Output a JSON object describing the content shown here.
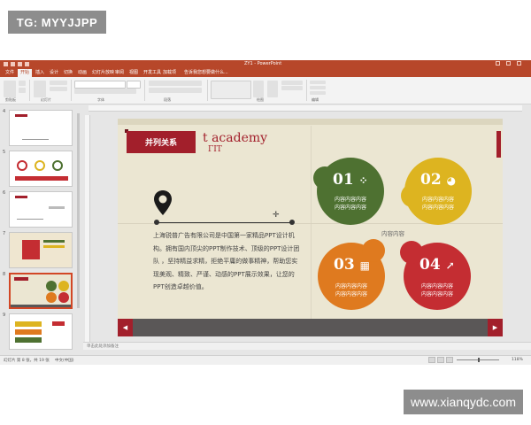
{
  "watermark_top": "TG: MYYJJPP",
  "watermark_bottom": "www.xianqydc.com",
  "window": {
    "doc_title": "ZY1 - PowerPoint"
  },
  "ribbon_tabs": [
    {
      "label": "文件",
      "active": false
    },
    {
      "label": "开始",
      "active": true
    },
    {
      "label": "插入",
      "active": false
    },
    {
      "label": "设计",
      "active": false
    },
    {
      "label": "切换",
      "active": false
    },
    {
      "label": "动画",
      "active": false
    },
    {
      "label": "幻灯片放映",
      "active": false
    },
    {
      "label": "审阅",
      "active": false
    },
    {
      "label": "视图",
      "active": false
    },
    {
      "label": "开发工具",
      "active": false
    },
    {
      "label": "加载项",
      "active": false
    }
  ],
  "tell_me": "告诉我您想要做什么...",
  "ribbon_groups": [
    "剪贴板",
    "幻灯片",
    "字体",
    "段落",
    "绘图",
    "编辑"
  ],
  "thumbnails": [
    {
      "num": "4"
    },
    {
      "num": "5"
    },
    {
      "num": "6"
    },
    {
      "num": "7"
    },
    {
      "num": "8"
    },
    {
      "num": "9"
    }
  ],
  "slide": {
    "title_tag": "并列关系",
    "academy": "t academy",
    "sub_design": "ΓIT",
    "paragraph": "上海锐普广告有限公司是中国第一家精品PPT设计机构。拥有国内顶尖的PPT制作技术、顶级的PPT设计团队 ，坚持精益求精，拒绝平庸的做事精神，帮助您实现美观、精致、严谨、动感的PPT展示效果，让您的PPT创造卓越价值。",
    "center_label": "内容内容",
    "circles": [
      {
        "num": "01",
        "glyph": "⁘",
        "line1": "内容内容内容",
        "line2": "内容内容内容",
        "color": "#4e7131"
      },
      {
        "num": "02",
        "glyph": "◕",
        "line1": "内容内容内容",
        "line2": "内容内容内容",
        "color": "#ddb420"
      },
      {
        "num": "03",
        "glyph": "▦",
        "line1": "内容内容内容",
        "line2": "内容内容内容",
        "color": "#df7a1f"
      },
      {
        "num": "04",
        "glyph": "↗",
        "line1": "内容内容内容",
        "line2": "内容内容内容",
        "color": "#c42d32"
      }
    ],
    "nav_prev": "◀",
    "nav_next": "▶"
  },
  "notes_placeholder": "单击此处添加备注",
  "status": {
    "slide_info": "幻灯片 第 8 张，共 19 张",
    "language": "中文(中国)",
    "zoom": "118%"
  },
  "colors": {
    "accent": "#b7472a",
    "title_red": "#a21f2b",
    "green": "#4e7131",
    "yellow": "#ddb420",
    "orange": "#df7a1f",
    "red": "#c42d32",
    "slide_bg": "#ebe6d2",
    "bottom_bar": "#5a5757"
  }
}
